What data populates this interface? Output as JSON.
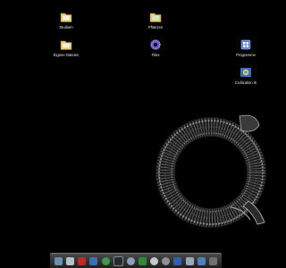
{
  "desktop": {
    "icons": [
      {
        "label": "Studium",
        "icon": "folder-icon"
      },
      {
        "label": "Pflanzen",
        "icon": "folder-icon"
      },
      {
        "label": "Eigene Dateien",
        "icon": "folder-icon"
      },
      {
        "label": "Files",
        "icon": "files-gear-icon"
      },
      {
        "label": "Programme",
        "icon": "programs-icon"
      },
      {
        "label": "Civilization III",
        "icon": "game-icon"
      }
    ]
  },
  "wallpaper": {
    "subject": "coiled-serpent-skeleton"
  },
  "dock": {
    "items": [
      {
        "icon": "finder-icon",
        "color": "#6a8fb0"
      },
      {
        "icon": "image-viewer-icon",
        "color": "#b8c0c8"
      },
      {
        "icon": "music-icon",
        "color": "#c02828"
      },
      {
        "icon": "mail-icon",
        "color": "#3a70b8"
      },
      {
        "icon": "browser-icon",
        "color": "#3a9a4a"
      },
      {
        "icon": "terminal-icon",
        "color": "#222a33"
      },
      {
        "icon": "settings-icon",
        "color": "#8aa0b8"
      },
      {
        "icon": "leaf-icon",
        "color": "#2e8b3a"
      },
      {
        "icon": "clock-icon",
        "color": "#c8c8c8"
      },
      {
        "icon": "disc-icon",
        "color": "#909090"
      },
      {
        "icon": "user-icon",
        "color": "#2e5fb0"
      },
      {
        "icon": "calendar-icon",
        "color": "#9aa8b8"
      },
      {
        "icon": "chat-icon",
        "color": "#4a80c0"
      },
      {
        "icon": "trash-icon",
        "color": "#707070"
      }
    ]
  }
}
